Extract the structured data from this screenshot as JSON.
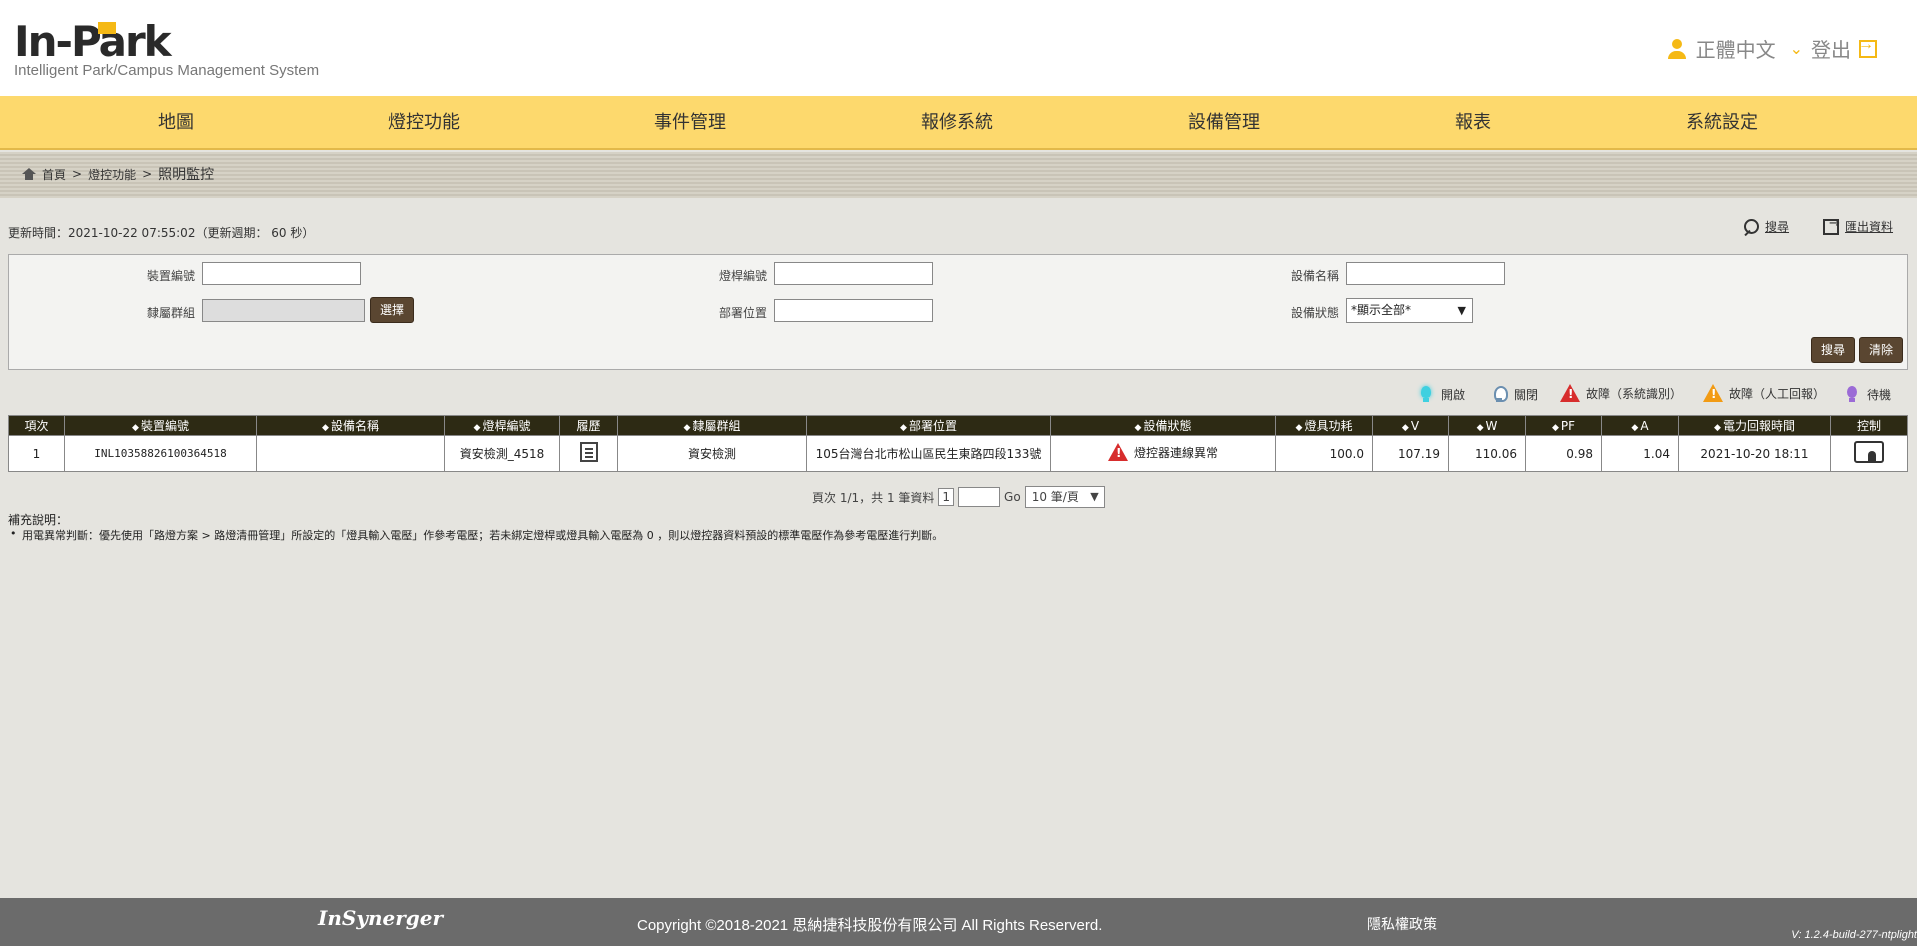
{
  "header": {
    "logo_main": "In-Park",
    "logo_sub": "Intelligent Park/Campus Management System",
    "language": "正體中文",
    "logout": "登出"
  },
  "nav": {
    "items": [
      "地圖",
      "燈控功能",
      "事件管理",
      "報修系統",
      "設備管理",
      "報表",
      "系統設定"
    ]
  },
  "breadcrumb": {
    "home": "首頁",
    "sep": ">",
    "level1": "燈控功能",
    "current": "照明監控"
  },
  "toolbar": {
    "update_text": "更新時間：2021-10-22 07:55:02（更新週期： 60 秒）",
    "search_label": "搜尋",
    "export_label": "匯出資料"
  },
  "filters": {
    "device_no_label": "裝置編號",
    "device_no_value": "",
    "pole_no_label": "燈桿編號",
    "pole_no_value": "",
    "device_name_label": "設備名稱",
    "device_name_value": "",
    "group_label": "隸屬群組",
    "group_value": "",
    "select_button": "選擇",
    "location_label": "部署位置",
    "location_value": "",
    "status_label": "設備狀態",
    "status_value": "*顯示全部*",
    "search_button": "搜尋",
    "clear_button": "清除"
  },
  "legend": {
    "on": "開啟",
    "off": "關閉",
    "fault_system": "故障（系統識別）",
    "fault_manual": "故障（人工回報）",
    "standby": "待機"
  },
  "table": {
    "headers": [
      "項次",
      "裝置編號",
      "設備名稱",
      "燈桿編號",
      "履歷",
      "隸屬群組",
      "部署位置",
      "設備狀態",
      "燈具功耗",
      "V",
      "W",
      "PF",
      "A",
      "電力回報時間",
      "控制"
    ],
    "rows": [
      {
        "index": "1",
        "device_no": "INL10358826100364518",
        "device_name": "",
        "pole_no": "資安檢測_4518",
        "group": "資安檢測",
        "location": "105台灣台北市松山區民生東路四段133號",
        "status": "燈控器連線異常",
        "power": "100.0",
        "v": "107.19",
        "w": "110.06",
        "pf": "0.98",
        "a": "1.04",
        "report_time": "2021-10-20 18:11"
      }
    ]
  },
  "pager": {
    "summary": "頁次 1/1，共 1 筆資料",
    "current_page": "1",
    "go_label": "Go",
    "page_size": "10 筆/頁"
  },
  "notes": {
    "title": "補充說明：",
    "item1": "用電異常判斷：優先使用「路燈方案 > 路燈清冊管理」所設定的「燈具輸入電壓」作參考電壓；若未綁定燈桿或燈具輸入電壓為 0 ，則以燈控器資料預設的標準電壓作為參考電壓進行判斷。"
  },
  "footer": {
    "logo": "InSynerger",
    "copyright": "Copyright ©2018-2021 思納捷科技股份有限公司 All Rights Reserverd.",
    "privacy": "隱私權政策",
    "version": "V: 1.2.4-build-277-ntplight"
  }
}
